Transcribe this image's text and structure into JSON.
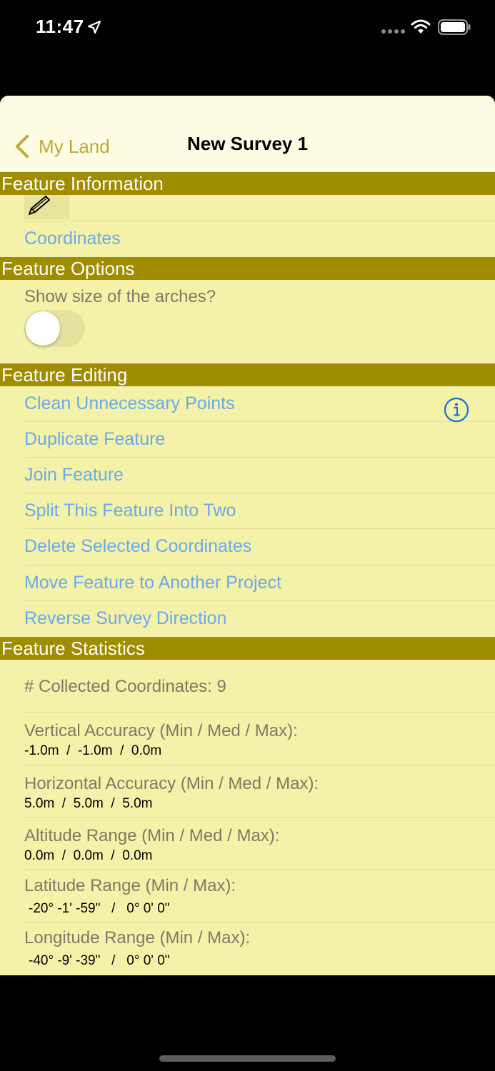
{
  "status_bar": {
    "time": "11:47"
  },
  "nav": {
    "back_label": "My Land",
    "title": "New Survey 1"
  },
  "sections": {
    "feature_information": {
      "header": "Feature Information",
      "coordinates_link": "Coordinates"
    },
    "feature_options": {
      "header": "Feature Options",
      "show_arches_label": "Show size of the arches?",
      "show_arches_on": false
    },
    "feature_editing": {
      "header": "Feature Editing",
      "actions": [
        "Clean Unnecessary Points",
        "Duplicate Feature",
        "Join Feature",
        "Split This Feature Into Two",
        "Delete Selected Coordinates",
        "Move Feature to Another Project",
        "Reverse Survey Direction"
      ]
    },
    "feature_statistics": {
      "header": "Feature Statistics",
      "collected": "# Collected Coordinates: 9",
      "vertical_label": "Vertical Accuracy (Min / Med / Max):",
      "vertical_value": "-1.0m  /  -1.0m  /  0.0m",
      "horizontal_label": "Horizontal Accuracy (Min / Med / Max):",
      "horizontal_value": "5.0m  /  5.0m  /  5.0m",
      "altitude_label": "Altitude Range (Min / Med / Max):",
      "altitude_value": "0.0m  /  0.0m  /  0.0m",
      "latitude_label": "Latitude Range (Min / Max):",
      "latitude_value": "-20° -1' -59\"   /   0° 0' 0\"",
      "longitude_label": "Longitude Range (Min / Max):",
      "longitude_value": "-40° -9' -39\"   /   0° 0' 0\""
    }
  },
  "colors": {
    "section_header_bg": "#a08c00",
    "sheet_bg": "#f4f1a9",
    "nav_bg": "#fefde4",
    "link": "#6aaaea",
    "accent": "#c2a63a"
  }
}
